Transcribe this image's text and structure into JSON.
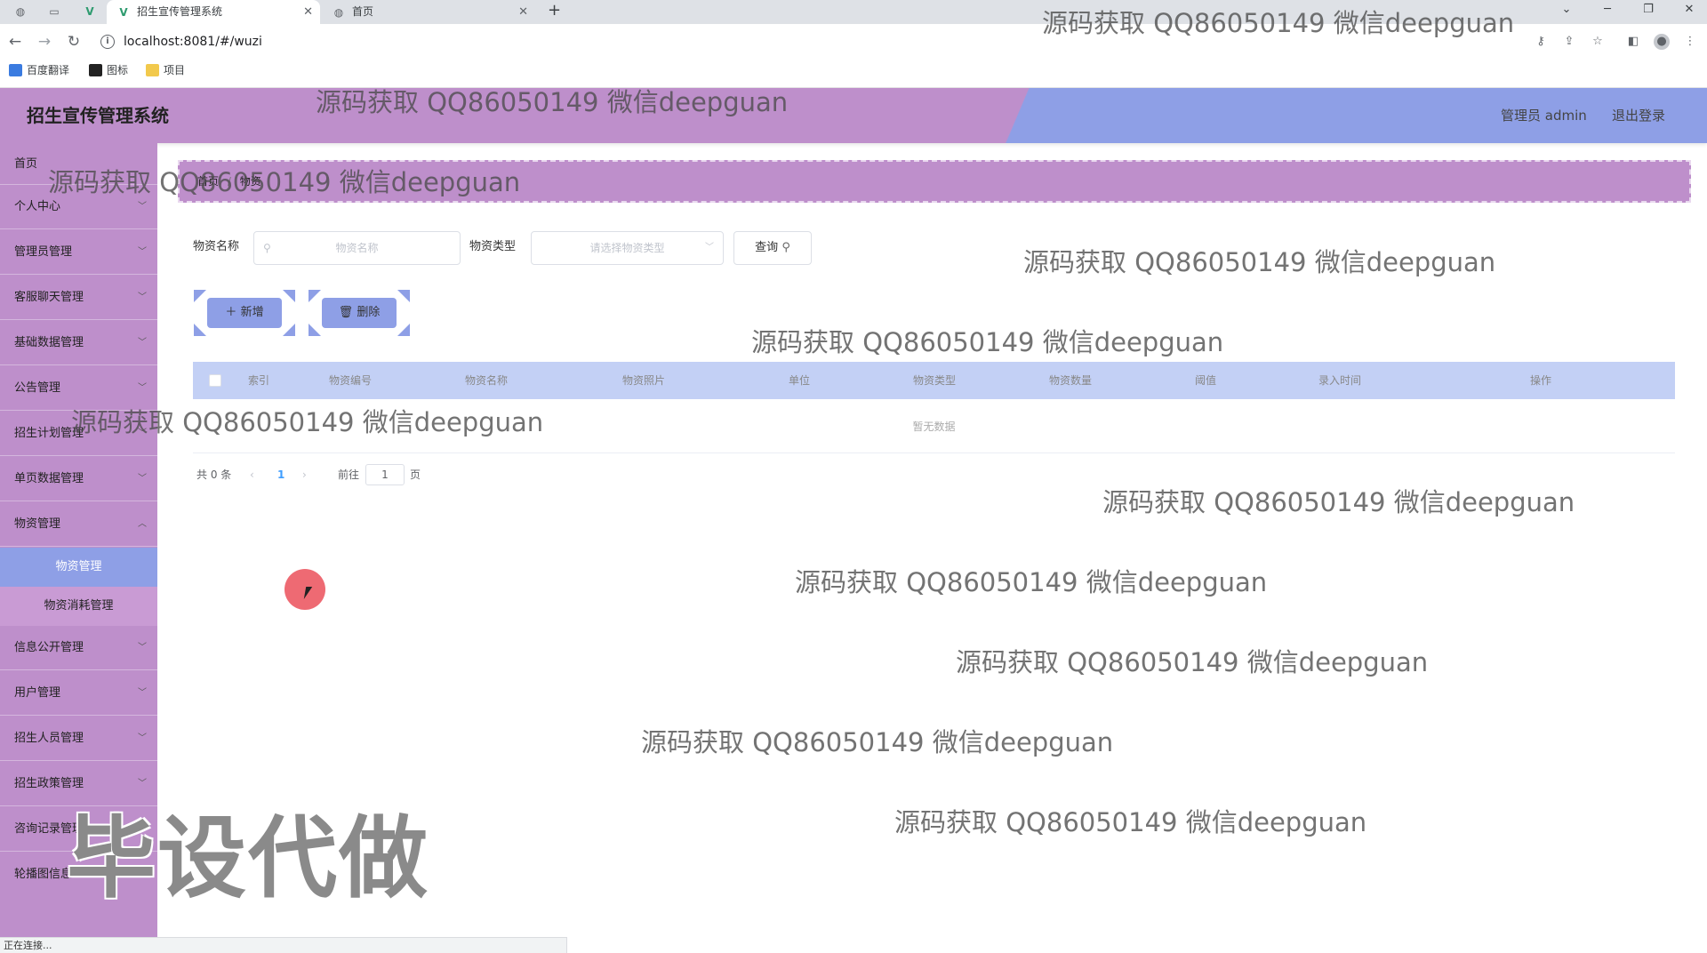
{
  "browser": {
    "tabs": [
      {
        "title": "招生宣传管理系统",
        "active": true
      },
      {
        "title": "首页",
        "active": false
      }
    ],
    "new_tab": "+",
    "url": "localhost:8081/#/wuzi",
    "bookmarks": [
      "百度翻译",
      "图标",
      "项目"
    ],
    "status": "正在连接..."
  },
  "header": {
    "title": "招生宣传管理系统",
    "admin_label": "管理员 admin",
    "logout_label": "退出登录"
  },
  "sidebar": {
    "home": "首页",
    "items": [
      "个人中心",
      "管理员管理",
      "客服聊天管理",
      "基础数据管理",
      "公告管理",
      "招生计划管理",
      "单页数据管理",
      "物资管理"
    ],
    "sub_items": [
      "物资管理",
      "物资消耗管理"
    ],
    "items_after": [
      "信息公开管理",
      "用户管理",
      "招生人员管理",
      "招生政策管理",
      "咨询记录管理",
      "轮播图信息"
    ]
  },
  "breadcrumb": {
    "home": "首页",
    "sep": "/",
    "current": "物资"
  },
  "filters": {
    "name_label": "物资名称",
    "name_placeholder": "物资名称",
    "type_label": "物资类型",
    "type_placeholder": "请选择物资类型",
    "query_label": "查询"
  },
  "actions": {
    "add_label": "新增",
    "delete_label": "删除"
  },
  "table": {
    "columns": [
      "索引",
      "物资编号",
      "物资名称",
      "物资照片",
      "单位",
      "物资类型",
      "物资数量",
      "阈值",
      "录入时间",
      "操作"
    ],
    "rows": [],
    "empty_text": "暂无数据"
  },
  "pagination": {
    "total_text": "共 0 条",
    "prev": "‹",
    "current_page": "1",
    "next": "›",
    "goto_label": "前往",
    "goto_value": "1",
    "page_suffix": "页"
  },
  "watermark": {
    "text": "源码获取 QQ86050149 微信deepguan",
    "stamp": "毕设代做"
  },
  "colors": {
    "purple": "#be8fcb",
    "blue": "#8e9fe6",
    "table_head": "#c3d0f5"
  }
}
